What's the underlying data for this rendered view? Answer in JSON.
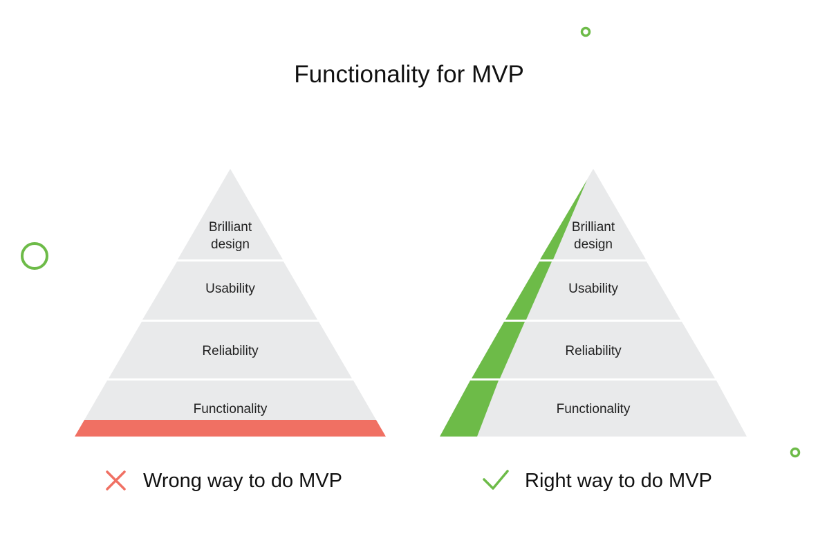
{
  "title": "Functionality for MVP",
  "colors": {
    "layer_fill": "#e9eaeb",
    "wrong_accent": "#f07063",
    "right_accent": "#6dbb48",
    "circle_stroke": "#6dbb48"
  },
  "pyramids": {
    "wrong": {
      "layers": [
        "Brilliant design",
        "Usability",
        "Reliability",
        "Functionality"
      ],
      "caption": "Wrong way to do MVP",
      "icon": "cross-icon"
    },
    "right": {
      "layers": [
        "Brilliant design",
        "Usability",
        "Reliability",
        "Functionality"
      ],
      "caption": "Right way to do MVP",
      "icon": "check-icon"
    }
  }
}
